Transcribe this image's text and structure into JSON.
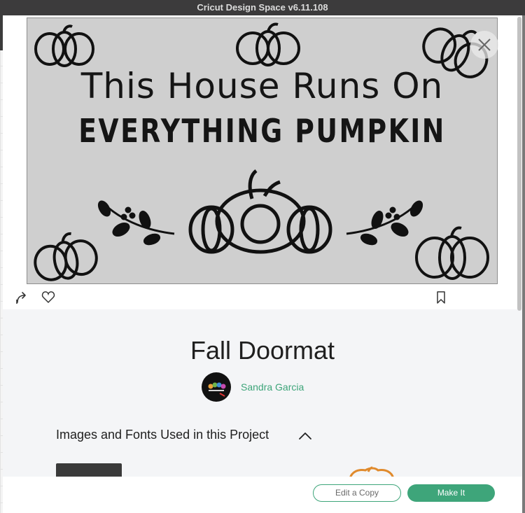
{
  "window": {
    "title": "Cricut Design Space  v6.11.108"
  },
  "design": {
    "line1": "This House Runs On",
    "line2": "EVERYTHING PUMPKIN"
  },
  "actions": {
    "share_icon": "share-arrow-icon",
    "like_icon": "heart-icon",
    "bookmark_icon": "bookmark-icon",
    "close_icon": "close-icon"
  },
  "project": {
    "title": "Fall Doormat",
    "author": "Sandra Garcia"
  },
  "section": {
    "heading": "Images and Fonts Used in this Project",
    "expanded": true
  },
  "footer": {
    "edit_label": "Edit a Copy",
    "make_label": "Make It"
  },
  "colors": {
    "accent": "#3ea57a",
    "mat": "#cfcfcf",
    "titlebar": "#3c3b3c"
  }
}
